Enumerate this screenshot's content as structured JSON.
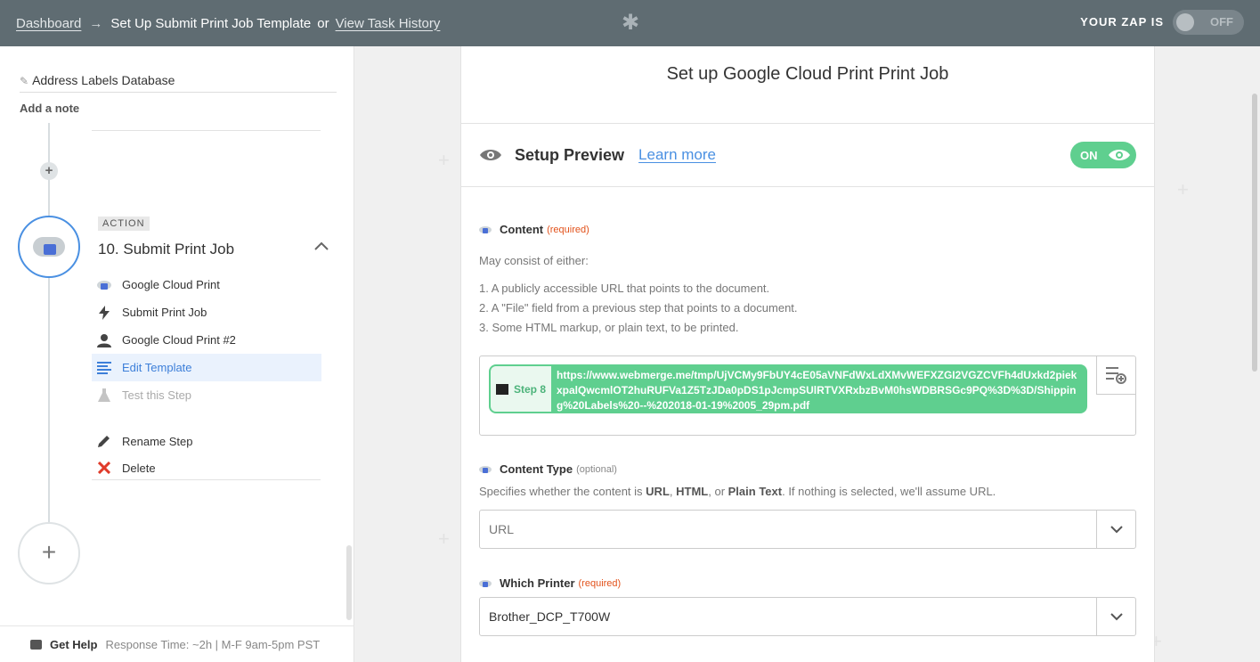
{
  "topbar": {
    "dashboard": "Dashboard",
    "arrow": "→",
    "current": "Set Up Submit Print Job Template",
    "or": "or",
    "history": "View Task History",
    "gear": "✱",
    "zap_label": "YOUR ZAP IS",
    "zap_state": "OFF"
  },
  "sidebar": {
    "zap_name": "Address Labels Database",
    "add_note": "Add a note",
    "step_badge": "ACTION",
    "step_title": "10. Submit Print Job",
    "items": [
      {
        "label": "Google Cloud Print",
        "icon": "google-cloud-print-icon"
      },
      {
        "label": "Submit Print Job",
        "icon": "bolt-icon"
      },
      {
        "label": "Google Cloud Print #2",
        "icon": "user-icon"
      },
      {
        "label": "Edit Template",
        "icon": "list-icon"
      },
      {
        "label": "Test this Step",
        "icon": "flask-icon"
      },
      {
        "label": "Rename Step",
        "icon": "pencil-icon"
      },
      {
        "label": "Delete",
        "icon": "close-icon"
      }
    ],
    "help_label": "Get Help",
    "help_text": "Response Time: ~2h | M-F 9am-5pm PST"
  },
  "main": {
    "title": "Set up Google Cloud Print Print Job",
    "preview_label": "Setup Preview",
    "learn_more": "Learn more",
    "preview_toggle": "ON",
    "content": {
      "label": "Content",
      "required": "(required)",
      "intro": "May consist of either:",
      "options": [
        "1. A publicly accessible URL that points to the document.",
        "2. A \"File\" field from a previous step that points to a document.",
        "3. Some HTML markup, or plain text, to be printed."
      ],
      "pill_step": "Step 8",
      "pill_url": "https://www.webmerge.me/tmp/UjVCMy9FbUY4cE05aVNFdWxLdXMvWEFXZGI2VGZCVFh4dUxkd2piekxpalQwcmlOT2huRUFVa1Z5TzJDa0pDS1pJcmpSUlRTVXRxbzBvM0hsWDBRSGc9PQ%3D%3D/Shipping%20Labels%20--%202018-01-19%2005_29pm.pdf"
    },
    "content_type": {
      "label": "Content Type",
      "optional": "(optional)",
      "help_pre": "Specifies whether the content is ",
      "opt1": "URL",
      "sep1": ", ",
      "opt2": "HTML",
      "sep2": ", or ",
      "opt3": "Plain Text",
      "help_post": ". If nothing is selected, we'll assume URL.",
      "value": "URL"
    },
    "printer": {
      "label": "Which Printer",
      "required": "(required)",
      "value": "Brother_DCP_T700W"
    }
  },
  "colors": {
    "topbar": "#5f6c72",
    "green": "#5fcf8f",
    "blue": "#4a90e2",
    "required": "#e2521b"
  }
}
